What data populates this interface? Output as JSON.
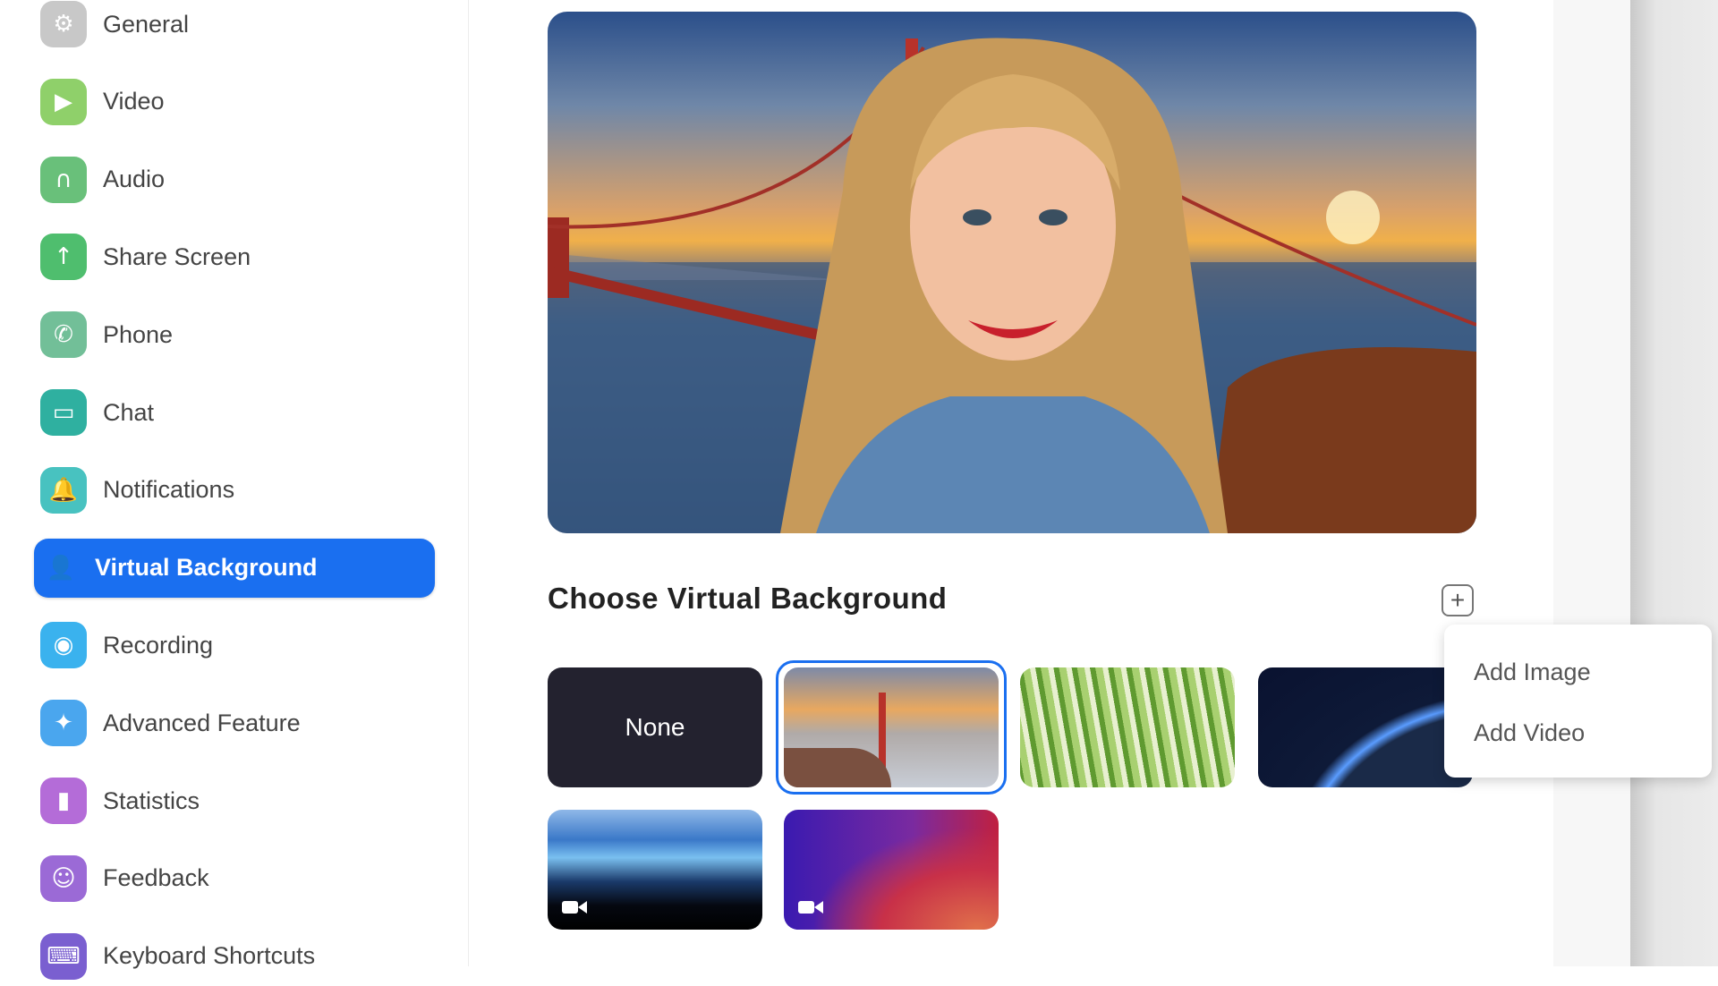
{
  "sidebar": {
    "items": [
      {
        "label": "General",
        "icon": "gear-icon",
        "color": "#c8c8c8"
      },
      {
        "label": "Video",
        "icon": "video-camera-icon",
        "color": "#8fd06a"
      },
      {
        "label": "Audio",
        "icon": "headphones-icon",
        "color": "#69c07a"
      },
      {
        "label": "Share Screen",
        "icon": "share-screen-icon",
        "color": "#4fbe6e"
      },
      {
        "label": "Phone",
        "icon": "phone-icon",
        "color": "#72bf98"
      },
      {
        "label": "Chat",
        "icon": "chat-icon",
        "color": "#2fb0a0"
      },
      {
        "label": "Notifications",
        "icon": "bell-icon",
        "color": "#48c2c0"
      },
      {
        "label": "Virtual Background",
        "icon": "virtual-background-icon",
        "color": "#1a6ff0",
        "active": true
      },
      {
        "label": "Recording",
        "icon": "record-icon",
        "color": "#3ab2ee"
      },
      {
        "label": "Advanced Feature",
        "icon": "sparkle-icon",
        "color": "#4aa6ee"
      },
      {
        "label": "Statistics",
        "icon": "bar-chart-icon",
        "color": "#b46cd8"
      },
      {
        "label": "Feedback",
        "icon": "smiley-icon",
        "color": "#9b6ad6"
      },
      {
        "label": "Keyboard Shortcuts",
        "icon": "keyboard-icon",
        "color": "#7a5fd0"
      }
    ]
  },
  "main": {
    "heading": "Choose Virtual Background",
    "add_menu": {
      "items": [
        "Add Image",
        "Add Video"
      ]
    },
    "thumbnails": [
      {
        "label": "None",
        "kind": "none"
      },
      {
        "kind": "image",
        "subject": "golden-gate-bridge",
        "selected": true
      },
      {
        "kind": "image",
        "subject": "grass"
      },
      {
        "kind": "image",
        "subject": "earth-from-space"
      },
      {
        "kind": "video",
        "subject": "earth-atmosphere"
      },
      {
        "kind": "video",
        "subject": "purple-gradient"
      }
    ]
  },
  "colors": {
    "accent": "#1a6ff0"
  }
}
